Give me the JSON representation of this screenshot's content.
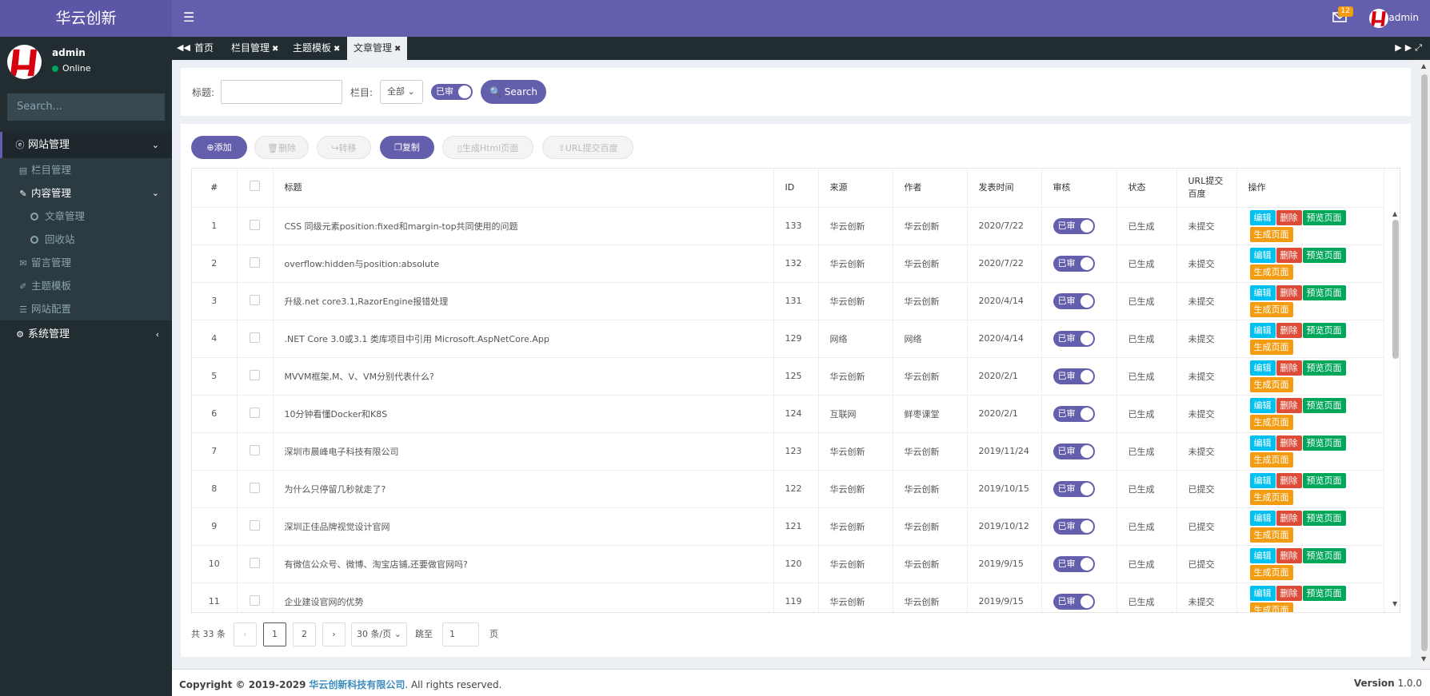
{
  "header": {
    "brand": "华云创新",
    "mail_count": "12",
    "user": "admin"
  },
  "sidebar": {
    "user_name": "admin",
    "status": "Online",
    "search_placeholder": "Search...",
    "menu": {
      "site": "网站管理",
      "column": "栏目管理",
      "content": "内容管理",
      "article": "文章管理",
      "recycle": "回收站",
      "message": "留言管理",
      "theme": "主题模板",
      "config": "网站配置",
      "system": "系统管理"
    }
  },
  "tabs": [
    "首页",
    "栏目管理",
    "主题模板",
    "文章管理"
  ],
  "filter": {
    "title_label": "标题:",
    "title_value": "",
    "column_label": "栏目:",
    "column_value": "全部",
    "audit_label": "已审",
    "search_label": "Search"
  },
  "toolbar": {
    "add": "添加",
    "delete": "删除",
    "move": "转移",
    "copy": "复制",
    "gen_html": "生成Html页面",
    "url_submit": "URL提交百度"
  },
  "table": {
    "headers": {
      "no": "#",
      "title": "标题",
      "id": "ID",
      "source": "来源",
      "author": "作者",
      "date": "发表时间",
      "audit": "审核",
      "status": "状态",
      "url": "URL提交百度",
      "ops": "操作"
    },
    "op_labels": {
      "edit": "编辑",
      "del": "删除",
      "preview": "预览页面",
      "gen": "生成页面"
    },
    "rows": [
      {
        "no": "1",
        "title": "CSS 同级元素position:fixed和margin-top共同使用的问题",
        "id": "133",
        "source": "华云创新",
        "author": "华云创新",
        "date": "2020/7/22",
        "audit": "已审",
        "status": "已生成",
        "url": "未提交"
      },
      {
        "no": "2",
        "title": "overflow:hidden与position:absolute",
        "id": "132",
        "source": "华云创新",
        "author": "华云创新",
        "date": "2020/7/22",
        "audit": "已审",
        "status": "已生成",
        "url": "未提交"
      },
      {
        "no": "3",
        "title": "升级.net core3.1,RazorEngine报错处理",
        "id": "131",
        "source": "华云创新",
        "author": "华云创新",
        "date": "2020/4/14",
        "audit": "已审",
        "status": "已生成",
        "url": "未提交"
      },
      {
        "no": "4",
        "title": ".NET Core 3.0或3.1 类库项目中引用 Microsoft.AspNetCore.App",
        "id": "129",
        "source": "网络",
        "author": "网络",
        "date": "2020/4/14",
        "audit": "已审",
        "status": "已生成",
        "url": "未提交"
      },
      {
        "no": "5",
        "title": "MVVM框架,M、V、VM分别代表什么?",
        "id": "125",
        "source": "华云创新",
        "author": "华云创新",
        "date": "2020/2/1",
        "audit": "已审",
        "status": "已生成",
        "url": "未提交"
      },
      {
        "no": "6",
        "title": "10分钟看懂Docker和K8S",
        "id": "124",
        "source": "互联网",
        "author": "鲜枣课堂",
        "date": "2020/2/1",
        "audit": "已审",
        "status": "已生成",
        "url": "未提交"
      },
      {
        "no": "7",
        "title": "深圳市晨峰电子科技有限公司",
        "id": "123",
        "source": "华云创新",
        "author": "华云创新",
        "date": "2019/11/24",
        "audit": "已审",
        "status": "已生成",
        "url": "未提交"
      },
      {
        "no": "8",
        "title": "为什么只停留几秒就走了?",
        "id": "122",
        "source": "华云创新",
        "author": "华云创新",
        "date": "2019/10/15",
        "audit": "已审",
        "status": "已生成",
        "url": "已提交"
      },
      {
        "no": "9",
        "title": "深圳正佳品牌视觉设计官网",
        "id": "121",
        "source": "华云创新",
        "author": "华云创新",
        "date": "2019/10/12",
        "audit": "已审",
        "status": "已生成",
        "url": "已提交"
      },
      {
        "no": "10",
        "title": "有微信公众号、微博、淘宝店铺,还要做官网吗?",
        "id": "120",
        "source": "华云创新",
        "author": "华云创新",
        "date": "2019/9/15",
        "audit": "已审",
        "status": "已生成",
        "url": "已提交"
      },
      {
        "no": "11",
        "title": "企业建设官网的优势",
        "id": "119",
        "source": "华云创新",
        "author": "华云创新",
        "date": "2019/9/15",
        "audit": "已审",
        "status": "已生成",
        "url": "未提交"
      }
    ]
  },
  "pager": {
    "total": "共 33 条",
    "pages": [
      "1",
      "2"
    ],
    "page_size": "30 条/页",
    "jump_label": "跳至",
    "jump_value": "1",
    "page_unit": "页"
  },
  "footer": {
    "copyright": "Copyright © 2019-2029",
    "company": "华云创新科技有限公司",
    "rights": ". All rights reserved.",
    "version_label": "Version",
    "version": "1.0.0"
  },
  "colors": {
    "primary": "#645fad",
    "sidebar": "#222d32",
    "edit": "#00c0ef",
    "delete": "#dd4b39",
    "preview": "#00a65a",
    "generate": "#f39c12"
  }
}
